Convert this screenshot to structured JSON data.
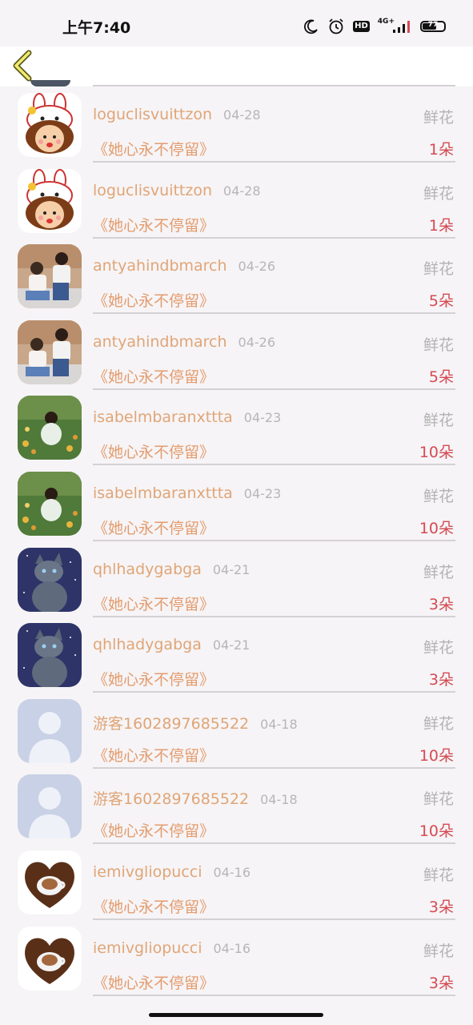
{
  "status_bar": {
    "time": "上午7:40",
    "icons": [
      "moon-icon",
      "alarm-icon",
      "hd-icon",
      "signal-icon",
      "battery-icon"
    ],
    "hd_label": "HD",
    "signal_label": "4G+",
    "battery_level": "77"
  },
  "nav": {
    "back_icon": "chevron-left-icon"
  },
  "rows": [
    {
      "name": "loguclisvuittzon",
      "date": "04-28",
      "gift": "鲜花",
      "song": "《她心永不停留》",
      "count": "1朵",
      "avatar": "bunny-cartoon"
    },
    {
      "name": "loguclisvuittzon",
      "date": "04-28",
      "gift": "鲜花",
      "song": "《她心永不停留》",
      "count": "1朵",
      "avatar": "bunny-cartoon"
    },
    {
      "name": "antyahindbmarch",
      "date": "04-26",
      "gift": "鲜花",
      "song": "《她心永不停留》",
      "count": "5朵",
      "avatar": "couple-photo"
    },
    {
      "name": "antyahindbmarch",
      "date": "04-26",
      "gift": "鲜花",
      "song": "《她心永不停留》",
      "count": "5朵",
      "avatar": "couple-photo"
    },
    {
      "name": "isabelmbaranxttta",
      "date": "04-23",
      "gift": "鲜花",
      "song": "《她心永不停留》",
      "count": "10朵",
      "avatar": "girl-flowers"
    },
    {
      "name": "isabelmbaranxttta",
      "date": "04-23",
      "gift": "鲜花",
      "song": "《她心永不停留》",
      "count": "10朵",
      "avatar": "girl-flowers"
    },
    {
      "name": "qhlhadygabga",
      "date": "04-21",
      "gift": "鲜花",
      "song": "《她心永不停留》",
      "count": "3朵",
      "avatar": "cat-night"
    },
    {
      "name": "qhlhadygabga",
      "date": "04-21",
      "gift": "鲜花",
      "song": "《她心永不停留》",
      "count": "3朵",
      "avatar": "cat-night"
    },
    {
      "name": "游客1602897685522",
      "date": "04-18",
      "gift": "鲜花",
      "song": "《她心永不停留》",
      "count": "10朵",
      "avatar": "default-user"
    },
    {
      "name": "游客1602897685522",
      "date": "04-18",
      "gift": "鲜花",
      "song": "《她心永不停留》",
      "count": "10朵",
      "avatar": "default-user"
    },
    {
      "name": "iemivgliopucci",
      "date": "04-16",
      "gift": "鲜花",
      "song": "《她心永不停留》",
      "count": "3朵",
      "avatar": "coffee-heart"
    },
    {
      "name": "iemivgliopucci",
      "date": "04-16",
      "gift": "鲜花",
      "song": "《她心永不停留》",
      "count": "3朵",
      "avatar": "coffee-heart"
    }
  ]
}
